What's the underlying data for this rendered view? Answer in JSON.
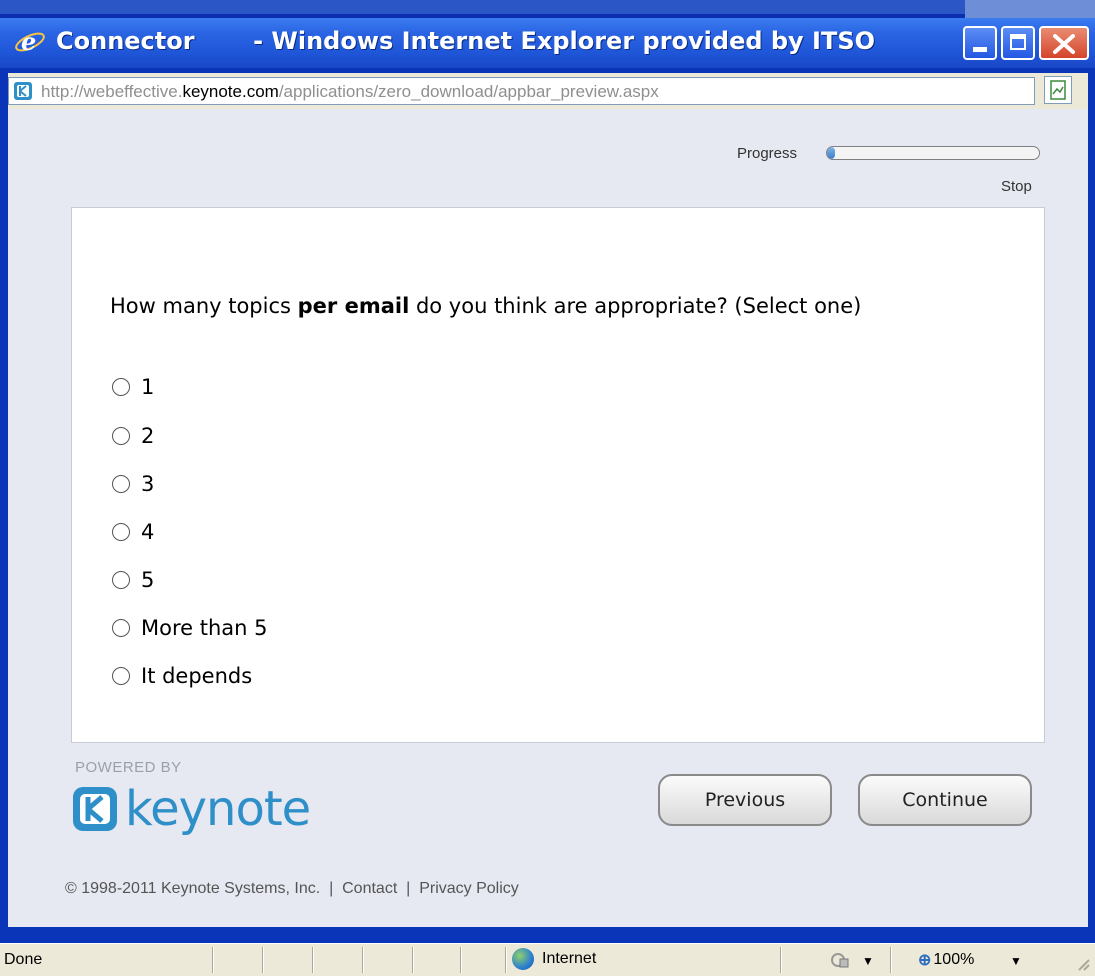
{
  "window": {
    "title": "Connector       - Windows Internet Explorer provided by ITSO",
    "url_prefix": "http://webeffective.",
    "url_domain": "keynote.com",
    "url_path": "/applications/zero_download/appbar_preview.aspx"
  },
  "survey": {
    "progress_label": "Progress",
    "progress_value": 0.04,
    "stop_label": "Stop",
    "question_pre": "How many topics ",
    "question_bold": "per email",
    "question_post": " do you think are appropriate? (Select one)",
    "options": [
      "1",
      "2",
      "3",
      "4",
      "5",
      "More than 5",
      "It depends"
    ],
    "previous_label": "Previous",
    "continue_label": "Continue"
  },
  "branding": {
    "powered_by": "POWERED BY",
    "brand_name": "keynote",
    "brand_color": "#2f8fc9",
    "footer": "© 1998-2011 Keynote Systems, Inc.  |  Contact  |  Privacy Policy"
  },
  "statusbar": {
    "status_text": "Done",
    "zone_text": "Internet",
    "zoom_text": "100%"
  }
}
